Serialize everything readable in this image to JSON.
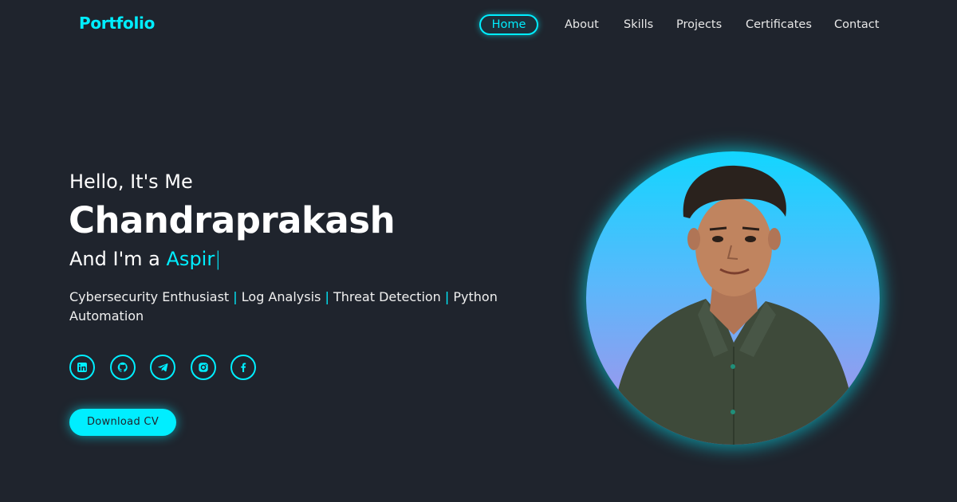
{
  "header": {
    "logo": "Portfolio",
    "nav": [
      {
        "label": "Home",
        "active": true
      },
      {
        "label": "About",
        "active": false
      },
      {
        "label": "Skills",
        "active": false
      },
      {
        "label": "Projects",
        "active": false
      },
      {
        "label": "Certificates",
        "active": false
      },
      {
        "label": "Contact",
        "active": false
      }
    ]
  },
  "hero": {
    "greeting": "Hello, It's Me",
    "name": "Chandraprakash",
    "role_prefix": "And I'm a ",
    "role_typed": "Aspir",
    "role_cursor": "|",
    "tagline": {
      "items": [
        "Cybersecurity Enthusiast",
        "Log Analysis",
        "Threat Detection",
        "Python Automation"
      ],
      "separator": "|"
    },
    "socials": [
      {
        "icon": "linkedin-icon"
      },
      {
        "icon": "github-icon"
      },
      {
        "icon": "telegram-icon"
      },
      {
        "icon": "instagram-icon"
      },
      {
        "icon": "facebook-icon"
      }
    ],
    "cv_button": "Download CV"
  },
  "colors": {
    "background": "#1f242d",
    "accent": "#00eeff",
    "text": "#ffffff"
  }
}
